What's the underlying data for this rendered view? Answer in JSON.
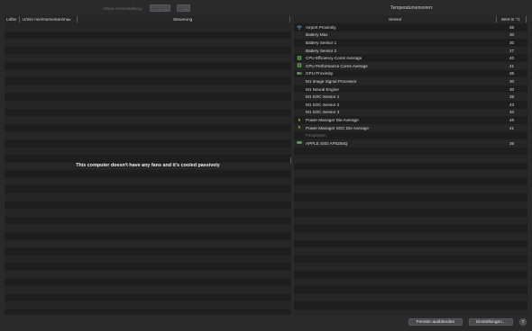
{
  "toolbar": {
    "preset_label": "Aktive Voreinstellung:",
    "temperature_title": "Temperatursensoren:"
  },
  "fans_table": {
    "columns": [
      "Lüfter",
      "U/min min/momentan/max",
      "Steuerung"
    ],
    "empty_message": "This computer doesn't have any fans and it's cooled passively"
  },
  "sensors_table": {
    "columns": [
      "Sensor",
      "Wert in °C"
    ],
    "rows": [
      {
        "name": "Airport Proximity",
        "value": "36",
        "icon": "wifi-icon"
      },
      {
        "name": "Battery Max",
        "value": "30",
        "icon": ""
      },
      {
        "name": "Battery Sensor 1",
        "value": "30",
        "icon": ""
      },
      {
        "name": "Battery Sensor 2",
        "value": "27",
        "icon": ""
      },
      {
        "name": "CPU Efficiency Cores Average",
        "value": "40",
        "icon": "cpu-icon"
      },
      {
        "name": "CPU Performance Cores Average",
        "value": "41",
        "icon": "cpu-icon"
      },
      {
        "name": "GPU Proximity",
        "value": "36",
        "icon": "gpu-icon"
      },
      {
        "name": "M1 Image Signal Processor",
        "value": "30",
        "icon": ""
      },
      {
        "name": "M1 Neural Engine",
        "value": "30",
        "icon": ""
      },
      {
        "name": "M1 SOC Sensor 1",
        "value": "39",
        "icon": ""
      },
      {
        "name": "M1 SOC Sensor 2",
        "value": "43",
        "icon": ""
      },
      {
        "name": "M1 SOC Sensor 3",
        "value": "40",
        "icon": ""
      },
      {
        "name": "Power Manager Die Average",
        "value": "46",
        "icon": "power-icon"
      },
      {
        "name": "Power Manager SOC Die Average",
        "value": "41",
        "icon": "power-icon"
      },
      {
        "name": "Festplatten",
        "value": "",
        "icon": "",
        "section": true
      },
      {
        "name": "APPLE SSD AP0256Q",
        "value": "36",
        "icon": "ssd-icon"
      }
    ]
  },
  "buttons": {
    "hide_window": "Fenster ausblenden",
    "settings": "Einstellungen...",
    "help": "?"
  },
  "colors": {
    "background": "#2a2a2b",
    "panel": "#1e1e1f",
    "cpu_icon": "#5a9a4a",
    "ssd_icon": "#4c8a5a",
    "wifi_icon": "#6aa8e0"
  }
}
